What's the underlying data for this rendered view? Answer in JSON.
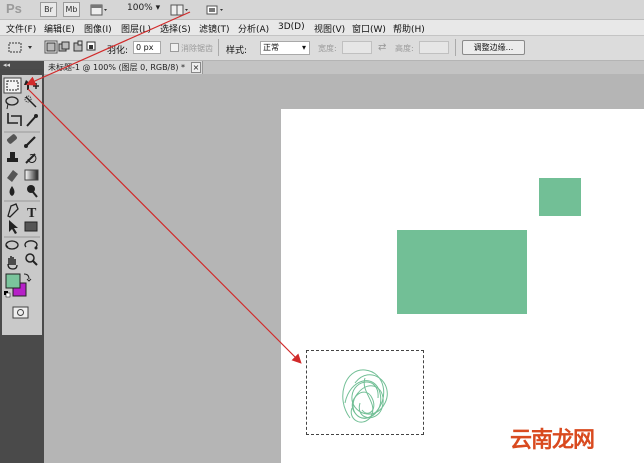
{
  "app": {
    "logo": "Ps",
    "buttons": [
      "Br",
      "Mb"
    ],
    "zoom": "100%"
  },
  "menu": [
    "文件(F)",
    "编辑(E)",
    "图像(I)",
    "图层(L)",
    "选择(S)",
    "滤镜(T)",
    "分析(A)",
    "3D(D)",
    "视图(V)",
    "窗口(W)",
    "帮助(H)"
  ],
  "options": {
    "feather_label": "羽化:",
    "feather_value": "0 px",
    "antialias_label": "消除锯齿",
    "style_label": "样式:",
    "style_value": "正常",
    "width_label": "宽度:",
    "height_label": "高度:",
    "refine_edge": "调整边缘..."
  },
  "document": {
    "tab_title": "未标题-1 @ 100% (图层 0, RGB/8) *",
    "close_glyph": "×"
  },
  "toolbox": {
    "tools": [
      "rect-marquee",
      "move",
      "lasso",
      "quick-select",
      "crop",
      "eyedropper",
      "healing-brush",
      "brush",
      "clone-stamp",
      "history-brush",
      "eraser",
      "gradient",
      "blur",
      "dodge",
      "pen",
      "type",
      "path-select",
      "rectangle-shape",
      "3d-rotate",
      "3d-orbit",
      "hand",
      "zoom"
    ],
    "foreground_color": "#7ac49c",
    "background_color": "#b620c8"
  },
  "colors": {
    "shape_fill": "#72bf96",
    "arrow": "#d12a2a"
  },
  "watermark": "云南龙网"
}
